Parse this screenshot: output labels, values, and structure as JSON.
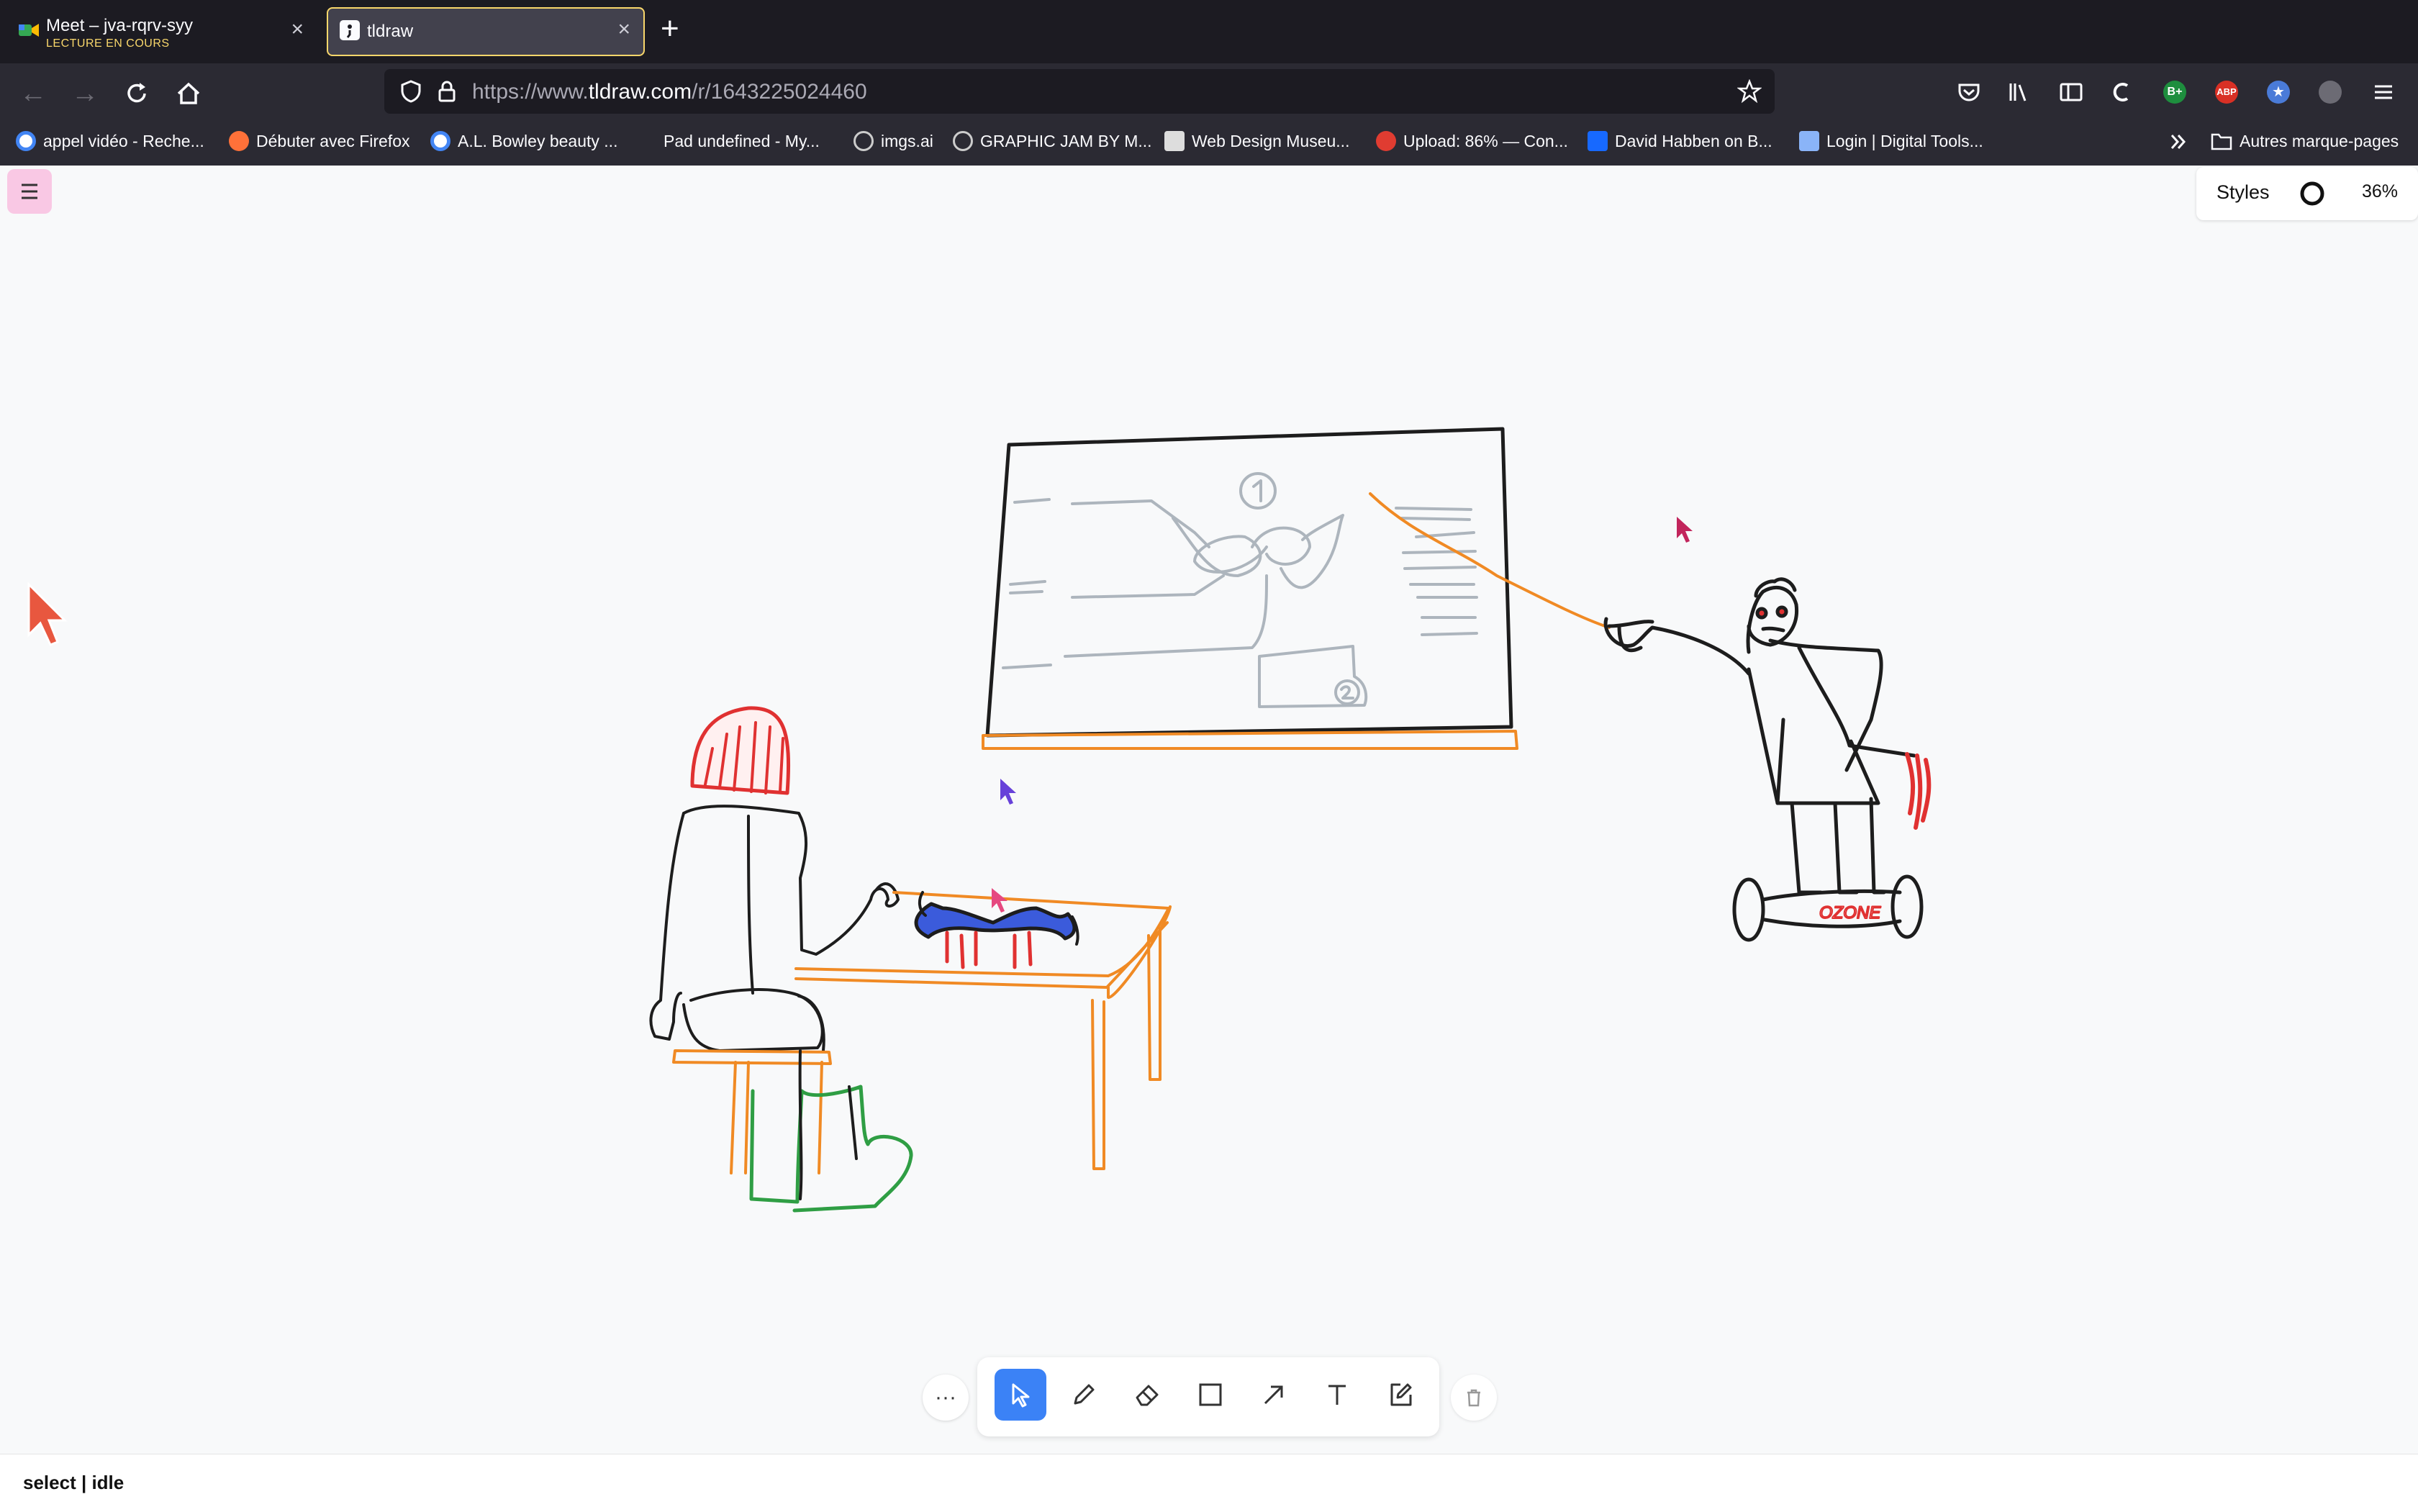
{
  "browser": {
    "tabs": [
      {
        "title": "Meet – jva-rqrv-syy",
        "subtitle": "LECTURE EN COURS",
        "active": false
      },
      {
        "title": "tldraw",
        "subtitle": "",
        "active": true
      }
    ],
    "url_prefix": "https://www.",
    "url_domain": "tldraw.com",
    "url_path": "/r/1643225024460",
    "bookmarks": [
      {
        "label": "appel vidéo - Reche...",
        "icon": "google-icon",
        "color": "#4285f4"
      },
      {
        "label": "Débuter avec Firefox",
        "icon": "firefox-icon",
        "color": "#ff7139"
      },
      {
        "label": "A.L. Bowley beauty ...",
        "icon": "google-icon",
        "color": "#4285f4"
      },
      {
        "label": "Pad undefined - My...",
        "icon": "pad-icon",
        "color": "#888888"
      },
      {
        "label": "imgs.ai",
        "icon": "globe-icon",
        "color": "#cccccc"
      },
      {
        "label": "GRAPHIC JAM BY M...",
        "icon": "globe-icon",
        "color": "#cccccc"
      },
      {
        "label": "Web Design Museu...",
        "icon": "museum-icon",
        "color": "#dddddd"
      },
      {
        "label": "Upload: 86% — Con...",
        "icon": "upload-icon",
        "color": "#e03c31"
      },
      {
        "label": "David Habben on B...",
        "icon": "behance-icon",
        "color": "#1769ff"
      },
      {
        "label": "Login | Digital Tools...",
        "icon": "tools-icon",
        "color": "#8ab4f8"
      }
    ],
    "other_bookmarks": "Autres marque-pages"
  },
  "app": {
    "styles_label": "Styles",
    "zoom": "36%",
    "status": "select | idle",
    "more_label": "···",
    "tools": [
      "select",
      "draw",
      "erase",
      "rectangle",
      "arrow",
      "text",
      "sticky"
    ],
    "active_tool": "select"
  },
  "colors": {
    "accent": "#3b82f6",
    "tab_highlight": "#f9d76b",
    "menu_button": "#f9c8e4",
    "drawing_black": "#1d1d1d",
    "drawing_orange": "#f08a24",
    "drawing_red": "#e03131",
    "drawing_green": "#2f9e44",
    "drawing_gray": "#adb5bd",
    "drawing_blue": "#3b5bdb"
  },
  "drawing": {
    "board_number_1": "1",
    "board_number_2": "2",
    "hoverboard_text": "OZONE"
  }
}
